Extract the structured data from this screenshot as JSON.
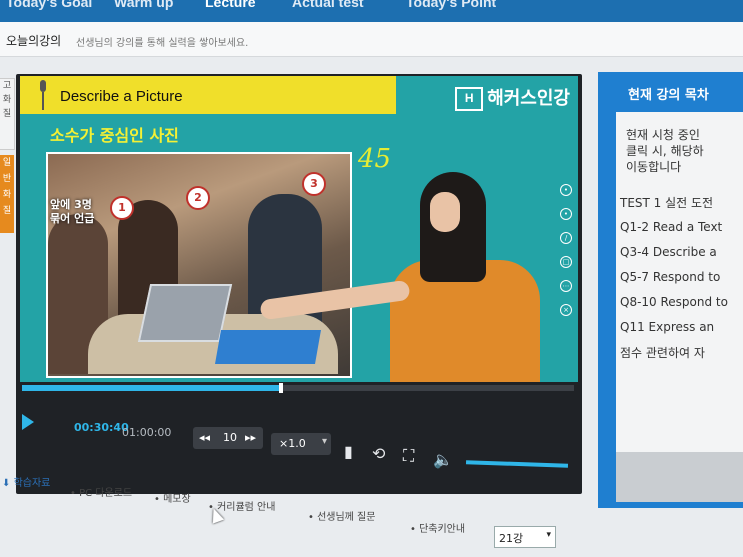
{
  "nav": {
    "tabs": [
      {
        "label": "Today's Goal"
      },
      {
        "label": "Warm up"
      },
      {
        "label": "Lecture"
      },
      {
        "label": "Actual test"
      },
      {
        "label": "Today's Point"
      }
    ],
    "active_tab": "Lecture"
  },
  "subheader": {
    "title": "오늘의강의",
    "description": "선생님의 강의를 통해 실력을 쌓아보세요."
  },
  "left_strip": {
    "chars": [
      "고",
      "화",
      "질"
    ],
    "orange_chars": [
      "일",
      "반",
      "화",
      "질"
    ]
  },
  "video": {
    "slide_title": "Describe a Picture",
    "brand": "해커스인강",
    "brand_logo": "H",
    "slide_subtitle": "소수가 중심인 사진",
    "handwritten_note": "45",
    "callout": "앞에 3명\n묶어 언급",
    "markers": [
      "1",
      "2",
      "3"
    ]
  },
  "player": {
    "current_time": "00:30:40",
    "total_time": "01:00:00",
    "progress": 0.47,
    "skip_seconds": "10",
    "speed": "×1.0",
    "volume": 0.85
  },
  "sidebar": {
    "title": "현재 강의 목차",
    "intro_lines": [
      "현재 시청 중인",
      "클릭 시, 해당하",
      "이동합니다"
    ],
    "items": [
      {
        "label": "TEST 1 실전 도전"
      },
      {
        "label": "Q1-2 Read a Text"
      },
      {
        "label": "Q3-4 Describe a"
      },
      {
        "label": "Q5-7 Respond to"
      },
      {
        "label": "Q8-10 Respond to"
      },
      {
        "label": "Q11 Express an"
      },
      {
        "label": "점수 관련하여 자"
      }
    ]
  },
  "bottom_links": [
    {
      "label": "학습자료"
    },
    {
      "label": "PC 다운로드"
    },
    {
      "label": "메모장"
    },
    {
      "label": "커리큘럼 안내"
    },
    {
      "label": "선생님께 질문"
    },
    {
      "label": "단축키안내"
    }
  ],
  "lecture_select": {
    "value": "21강"
  },
  "colors": {
    "nav_blue": "#1d6fb0",
    "accent_cyan": "#2fb6e8",
    "slide_teal": "#23a3a6",
    "slide_yellow": "#f0df2a",
    "orange": "#e68a1e"
  },
  "icons": [
    "mic-icon",
    "play-icon",
    "rewind-icon",
    "forward-icon",
    "bookmark-icon",
    "repeat-icon",
    "fullscreen-icon",
    "volume-icon",
    "download-icon",
    "chevron-down-icon"
  ]
}
